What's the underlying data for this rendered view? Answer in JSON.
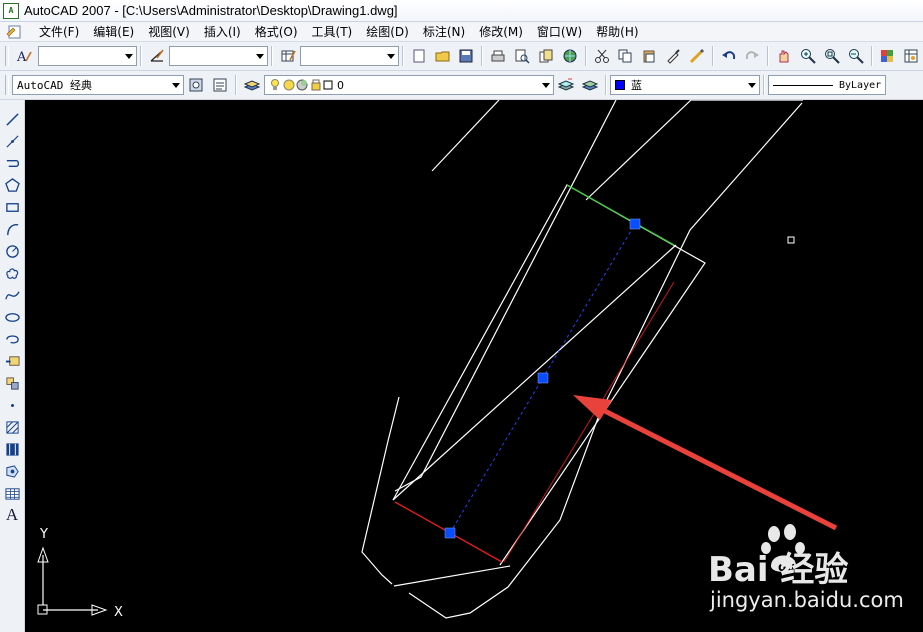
{
  "window": {
    "title": "AutoCAD 2007 - [C:\\Users\\Administrator\\Desktop\\Drawing1.dwg]"
  },
  "menu": {
    "items": [
      {
        "label": "文件(F)"
      },
      {
        "label": "编辑(E)"
      },
      {
        "label": "视图(V)"
      },
      {
        "label": "插入(I)"
      },
      {
        "label": "格式(O)"
      },
      {
        "label": "工具(T)"
      },
      {
        "label": "绘图(D)"
      },
      {
        "label": "标注(N)"
      },
      {
        "label": "修改(M)"
      },
      {
        "label": "窗口(W)"
      },
      {
        "label": "帮助(H)"
      }
    ]
  },
  "toolbar2": {
    "workspace": "AutoCAD 经典",
    "layer": "0",
    "color_name": "蓝",
    "color_swatch": "#0000ff",
    "linetype": "ByLayer"
  },
  "ucs": {
    "x_label": "X",
    "y_label": "Y"
  },
  "watermark": {
    "brand": "Bai 经验",
    "url": "jingyan.baidu.com"
  },
  "colors": {
    "canvas": "#000000",
    "grip": "#0a4dff",
    "annotation_arrow": "#e8423a",
    "green_edge": "#3ccc3c",
    "red_edge": "#e81c1c"
  }
}
